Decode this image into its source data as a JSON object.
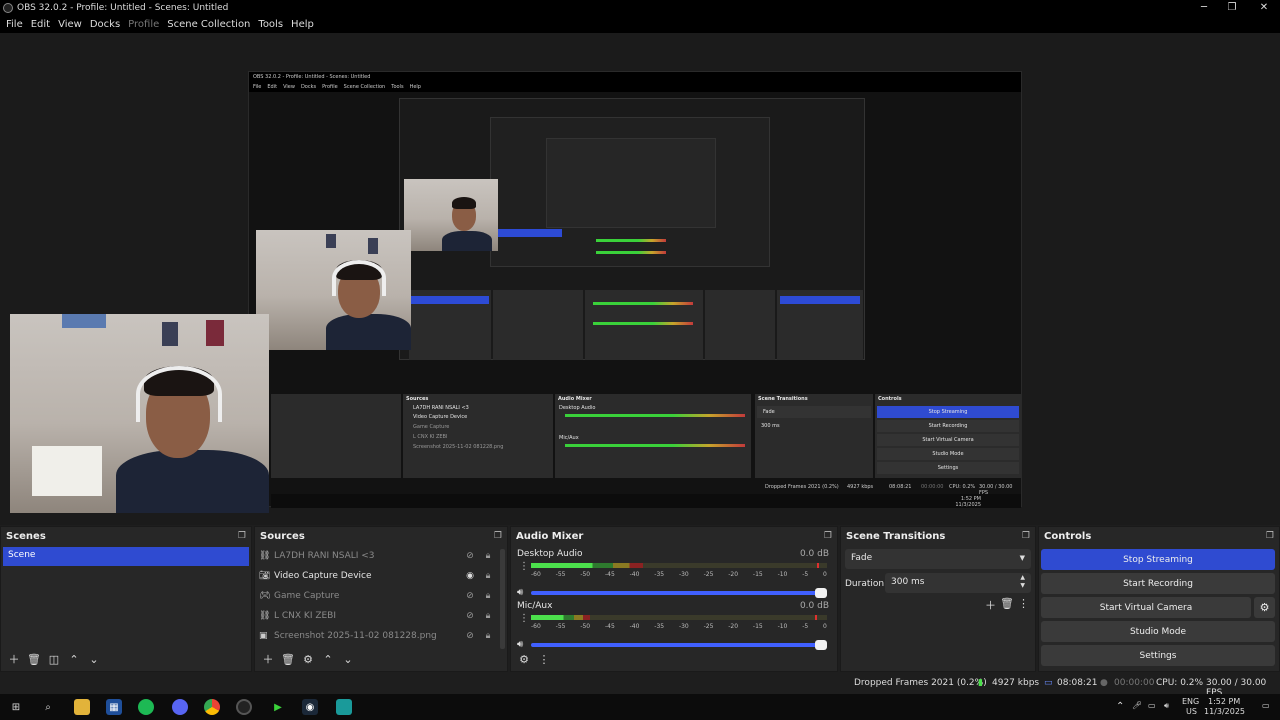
{
  "window": {
    "title": "OBS 32.0.2 - Profile: Untitled - Scenes: Untitled",
    "minimize": "─",
    "maximize": "❐",
    "close": "✕"
  },
  "menu": {
    "items": [
      "File",
      "Edit",
      "View",
      "Docks",
      "Profile",
      "Scene Collection",
      "Tools",
      "Help"
    ]
  },
  "nested": {
    "title": "OBS 32.0.2 - Profile: Untitled - Scenes: Untitled",
    "menu": [
      "File",
      "Edit",
      "View",
      "Docks",
      "Profile",
      "Scene Collection",
      "Tools",
      "Help"
    ],
    "sources_title": "Sources",
    "sources": [
      "LA7DH RANI NSALI <3",
      "Video Capture Device",
      "Game Capture",
      "L CNX KI ZEBI",
      "Screenshot 2025-11-02 081228.png"
    ],
    "mixer_title": "Audio Mixer",
    "desktop_audio": "Desktop Audio",
    "mic": "Mic/Aux",
    "db": "0.0 dB",
    "transitions_title": "Scene Transitions",
    "transition": "Fade",
    "duration_label": "Duration",
    "duration": "300 ms",
    "controls_title": "Controls",
    "stop_streaming": "Stop Streaming",
    "start_recording": "Start Recording",
    "start_virtual_camera": "Start Virtual Camera",
    "studio_mode": "Studio Mode",
    "settings": "Settings",
    "dropped": "Dropped Frames 2021 (0.2%)",
    "kbps": "4927 kbps",
    "time": "08:08:21",
    "rec_time": "00:00:00",
    "cpu": "CPU: 0.2%",
    "fps": "30.00 / 30.00 FPS",
    "clock": "1:52 PM",
    "date": "11/3/2025"
  },
  "scenes_dock": {
    "title": "Scenes",
    "items": [
      "Scene"
    ]
  },
  "sources_dock": {
    "title": "Sources",
    "items": [
      {
        "name": "LA7DH RANI NSALI <3",
        "icon": "link-icon",
        "visible": false
      },
      {
        "name": "Video Capture Device",
        "icon": "camera-icon",
        "visible": true
      },
      {
        "name": "Game Capture",
        "icon": "gamepad-icon",
        "visible": false
      },
      {
        "name": "L CNX KI ZEBI",
        "icon": "link-icon",
        "visible": false
      },
      {
        "name": "Screenshot 2025-11-02 081228.png",
        "icon": "image-icon",
        "visible": false
      }
    ]
  },
  "mixer_dock": {
    "title": "Audio Mixer",
    "ticks": [
      "-60",
      "-55",
      "-50",
      "-45",
      "-40",
      "-35",
      "-30",
      "-25",
      "-20",
      "-15",
      "-10",
      "-5",
      "0"
    ],
    "channels": [
      {
        "name": "Desktop Audio",
        "db": "0.0 dB",
        "level": 0.38,
        "volume": 1.0
      },
      {
        "name": "Mic/Aux",
        "db": "0.0 dB",
        "level": 0.2,
        "volume": 1.0
      }
    ]
  },
  "transitions_dock": {
    "title": "Scene Transitions",
    "transition": "Fade",
    "duration_label": "Duration",
    "duration": "300 ms"
  },
  "controls_dock": {
    "title": "Controls",
    "stop_streaming": "Stop Streaming",
    "start_recording": "Start Recording",
    "start_virtual_camera": "Start Virtual Camera",
    "studio_mode": "Studio Mode",
    "settings": "Settings"
  },
  "status": {
    "dropped": "Dropped Frames 2021 (0.2%)",
    "kbps": "4927 kbps",
    "stream_time": "08:08:21",
    "rec_time": "00:00:00",
    "cpu": "CPU: 0.2%",
    "fps": "30.00 / 30.00 FPS"
  },
  "taskbar": {
    "lang_top": "ENG",
    "lang_bottom": "US",
    "time": "1:52 PM",
    "date": "11/3/2025"
  },
  "colors": {
    "accent": "#2f4bd1",
    "meter_green": "#4ce04c",
    "meter_red": "#e03030"
  }
}
